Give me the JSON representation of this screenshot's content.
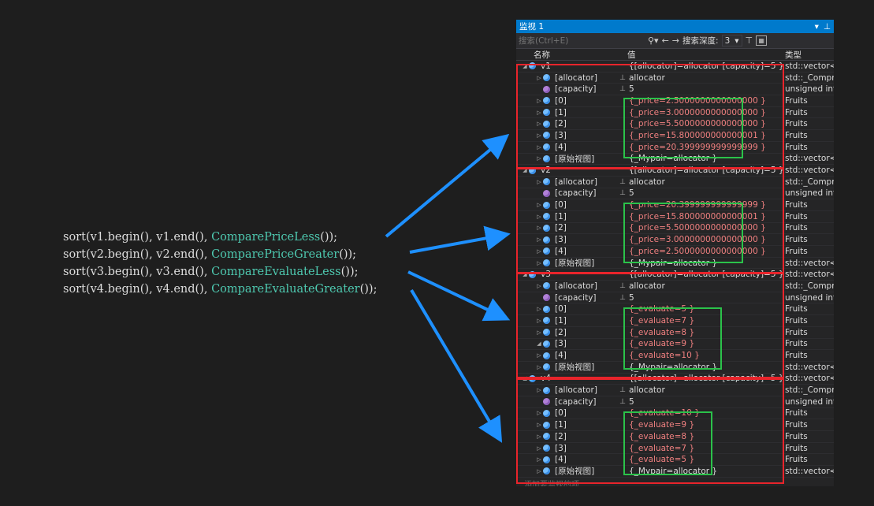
{
  "code": {
    "lines": [
      {
        "fn": "sort",
        "open": "(",
        "a": "v1.begin(), ",
        "b": "v1.end(), ",
        "comparator": "ComparePriceLess",
        "tail": "());"
      },
      {
        "fn": "sort",
        "open": "(",
        "a": "v2.begin(), ",
        "b": "v2.end(), ",
        "comparator": "ComparePriceGreater",
        "tail": "());"
      },
      {
        "fn": "sort",
        "open": "(",
        "a": "v3.begin(), ",
        "b": "v3.end(), ",
        "comparator": "CompareEvaluateLess",
        "tail": "());"
      },
      {
        "fn": "sort",
        "open": "(",
        "a": "v4.begin(), ",
        "b": "v4.end(), ",
        "comparator": "CompareEvaluateGreater",
        "tail": "());"
      }
    ]
  },
  "watch": {
    "title": "监视 1",
    "search_placeholder": "搜索(Ctrl+E)",
    "search_depth_label": "搜索深度:",
    "search_depth_value": "3",
    "headers": {
      "name": "名称",
      "value": "值",
      "type": "类型"
    },
    "add_watch": "添加要监视的项",
    "rows": [
      {
        "name": "v1",
        "value": "{[allocator]=allocator [capacity]=5 }",
        "type": "std::vector<...",
        "level": 0,
        "expanded": true,
        "icon": "blue",
        "changed": false,
        "pin": false
      },
      {
        "name": "[allocator]",
        "value": "allocator",
        "type": "std::_Compr...",
        "level": 1,
        "expanded": false,
        "icon": "blue",
        "changed": false,
        "pin": true
      },
      {
        "name": "[capacity]",
        "value": "5",
        "type": "unsigned int",
        "level": 1,
        "expanded": null,
        "icon": "purple",
        "changed": false,
        "pin": true
      },
      {
        "name": "[0]",
        "value": "{_price=2.5000000000000000 }",
        "type": "Fruits",
        "level": 1,
        "expanded": false,
        "icon": "blue",
        "changed": true,
        "pin": false
      },
      {
        "name": "[1]",
        "value": "{_price=3.0000000000000000 }",
        "type": "Fruits",
        "level": 1,
        "expanded": false,
        "icon": "blue",
        "changed": true,
        "pin": false
      },
      {
        "name": "[2]",
        "value": "{_price=5.5000000000000000 }",
        "type": "Fruits",
        "level": 1,
        "expanded": false,
        "icon": "blue",
        "changed": true,
        "pin": false
      },
      {
        "name": "[3]",
        "value": "{_price=15.800000000000001 }",
        "type": "Fruits",
        "level": 1,
        "expanded": false,
        "icon": "blue",
        "changed": true,
        "pin": false
      },
      {
        "name": "[4]",
        "value": "{_price=20.399999999999999 }",
        "type": "Fruits",
        "level": 1,
        "expanded": false,
        "icon": "blue",
        "changed": true,
        "pin": false
      },
      {
        "name": "[原始视图]",
        "value": "{_Mypair=allocator }",
        "type": "std::vector<...",
        "level": 1,
        "expanded": false,
        "icon": "blue",
        "changed": false,
        "pin": false
      },
      {
        "name": "v2",
        "value": "{[allocator]=allocator [capacity]=5 }",
        "type": "std::vector<...",
        "level": 0,
        "expanded": true,
        "icon": "blue",
        "changed": false,
        "pin": false
      },
      {
        "name": "[allocator]",
        "value": "allocator",
        "type": "std::_Compr...",
        "level": 1,
        "expanded": false,
        "icon": "blue",
        "changed": false,
        "pin": true
      },
      {
        "name": "[capacity]",
        "value": "5",
        "type": "unsigned int",
        "level": 1,
        "expanded": null,
        "icon": "purple",
        "changed": false,
        "pin": true
      },
      {
        "name": "[0]",
        "value": "{_price=20.399999999999999 }",
        "type": "Fruits",
        "level": 1,
        "expanded": false,
        "icon": "blue",
        "changed": true,
        "pin": false
      },
      {
        "name": "[1]",
        "value": "{_price=15.800000000000001 }",
        "type": "Fruits",
        "level": 1,
        "expanded": false,
        "icon": "blue",
        "changed": true,
        "pin": false
      },
      {
        "name": "[2]",
        "value": "{_price=5.5000000000000000 }",
        "type": "Fruits",
        "level": 1,
        "expanded": false,
        "icon": "blue",
        "changed": true,
        "pin": false
      },
      {
        "name": "[3]",
        "value": "{_price=3.0000000000000000 }",
        "type": "Fruits",
        "level": 1,
        "expanded": false,
        "icon": "blue",
        "changed": true,
        "pin": false
      },
      {
        "name": "[4]",
        "value": "{_price=2.5000000000000000 }",
        "type": "Fruits",
        "level": 1,
        "expanded": false,
        "icon": "blue",
        "changed": true,
        "pin": false
      },
      {
        "name": "[原始视图]",
        "value": "{_Mypair=allocator }",
        "type": "std::vector<...",
        "level": 1,
        "expanded": false,
        "icon": "blue",
        "changed": false,
        "pin": false
      },
      {
        "name": "v3",
        "value": "{[allocator]=allocator [capacity]=5 }",
        "type": "std::vector<...",
        "level": 0,
        "expanded": true,
        "icon": "blue",
        "changed": false,
        "pin": false
      },
      {
        "name": "[allocator]",
        "value": "allocator",
        "type": "std::_Compr...",
        "level": 1,
        "expanded": false,
        "icon": "blue",
        "changed": false,
        "pin": true
      },
      {
        "name": "[capacity]",
        "value": "5",
        "type": "unsigned int",
        "level": 1,
        "expanded": null,
        "icon": "purple",
        "changed": false,
        "pin": true
      },
      {
        "name": "[0]",
        "value": "{_evaluate=5 }",
        "type": "Fruits",
        "level": 1,
        "expanded": false,
        "icon": "blue",
        "changed": true,
        "pin": false
      },
      {
        "name": "[1]",
        "value": "{_evaluate=7 }",
        "type": "Fruits",
        "level": 1,
        "expanded": false,
        "icon": "blue",
        "changed": true,
        "pin": false
      },
      {
        "name": "[2]",
        "value": "{_evaluate=8 }",
        "type": "Fruits",
        "level": 1,
        "expanded": false,
        "icon": "blue",
        "changed": true,
        "pin": false
      },
      {
        "name": "[3]",
        "value": "{_evaluate=9 }",
        "type": "Fruits",
        "level": 1,
        "expanded": true,
        "icon": "blue",
        "changed": true,
        "pin": false
      },
      {
        "name": "[4]",
        "value": "{_evaluate=10 }",
        "type": "Fruits",
        "level": 1,
        "expanded": false,
        "icon": "blue",
        "changed": true,
        "pin": false
      },
      {
        "name": "[原始视图]",
        "value": "{_Mypair=allocator }",
        "type": "std::vector<...",
        "level": 1,
        "expanded": false,
        "icon": "blue",
        "changed": false,
        "pin": false
      },
      {
        "name": "v4",
        "value": "{[allocator]=allocator [capacity]=5 }",
        "type": "std::vector<...",
        "level": 0,
        "expanded": true,
        "icon": "blue",
        "changed": false,
        "pin": false
      },
      {
        "name": "[allocator]",
        "value": "allocator",
        "type": "std::_Compr...",
        "level": 1,
        "expanded": false,
        "icon": "blue",
        "changed": false,
        "pin": true
      },
      {
        "name": "[capacity]",
        "value": "5",
        "type": "unsigned int",
        "level": 1,
        "expanded": null,
        "icon": "purple",
        "changed": false,
        "pin": true
      },
      {
        "name": "[0]",
        "value": "{_evaluate=10 }",
        "type": "Fruits",
        "level": 1,
        "expanded": false,
        "icon": "blue",
        "changed": true,
        "pin": false
      },
      {
        "name": "[1]",
        "value": "{_evaluate=9 }",
        "type": "Fruits",
        "level": 1,
        "expanded": false,
        "icon": "blue",
        "changed": true,
        "pin": false
      },
      {
        "name": "[2]",
        "value": "{_evaluate=8 }",
        "type": "Fruits",
        "level": 1,
        "expanded": false,
        "icon": "blue",
        "changed": true,
        "pin": false
      },
      {
        "name": "[3]",
        "value": "{_evaluate=7 }",
        "type": "Fruits",
        "level": 1,
        "expanded": false,
        "icon": "blue",
        "changed": true,
        "pin": false
      },
      {
        "name": "[4]",
        "value": "{_evaluate=5 }",
        "type": "Fruits",
        "level": 1,
        "expanded": false,
        "icon": "blue",
        "changed": true,
        "pin": false
      },
      {
        "name": "[原始视图]",
        "value": "{_Mypair=allocator }",
        "type": "std::vector<...",
        "level": 1,
        "expanded": false,
        "icon": "blue",
        "changed": false,
        "pin": false
      }
    ]
  },
  "colors": {
    "accent": "#007acc",
    "red_highlight": "#e8242b",
    "green_highlight": "#2bc24a",
    "arrow": "#1e90ff",
    "comparator": "#4ec9b0",
    "changed_value": "#f08080"
  }
}
